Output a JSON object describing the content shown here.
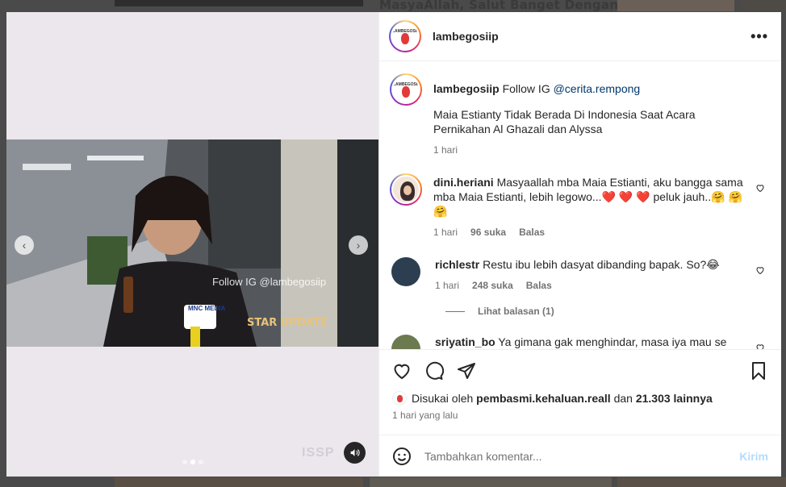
{
  "background": {
    "headline": "MasyaAllah, Salut Banget Dengan"
  },
  "post": {
    "username": "lambegosiip",
    "logo_text": "LAMBEGOSIIP",
    "video": {
      "overlay_text": "Follow IG @lambegosiip",
      "brand_text": "STAR UPDATE",
      "mic_label": "MNC MEDIA",
      "corner_watermark": "ISSP",
      "slide_count": 3,
      "active_slide": 2
    },
    "caption": {
      "username": "lambegosiip",
      "prefix": "Follow IG",
      "mention": "@cerita.rempong",
      "text": "Maia Estianty Tidak Berada Di Indonesia Saat Acara Pernikahan Al Ghazali dan Alyssa",
      "time": "1 hari"
    },
    "comments": [
      {
        "username": "dini.heriani",
        "text": "Masyaallah mba Maia Estianti, aku bangga sama mba Maia Estianti, lebih legowo...❤️ ❤️ ❤️ peluk jauh..🤗 🤗 🤗",
        "time": "1 hari",
        "likes": "96 suka",
        "reply": "Balas",
        "avatar_color": "#f3e5d8"
      },
      {
        "username": "richlestr",
        "text": "Restu ibu lebih dasyat dibanding bapak. So?😂",
        "time": "1 hari",
        "likes": "248 suka",
        "reply": "Balas",
        "view_replies": "Lihat balasan (1)",
        "avatar_color": "#2c3e50"
      },
      {
        "username": "sriyatin_bo",
        "text": "Ya gimana gak menghindar, masa iya mau se jajar",
        "avatar_color": "#6b7a4f"
      }
    ],
    "likes": {
      "prefix": "Disukai oleh",
      "user": "pembasmi.kehaluan.reall",
      "connector": "dan",
      "others": "21.303 lainnya"
    },
    "time_ago": "1 hari yang lalu",
    "comment_input": {
      "placeholder": "Tambahkan komentar...",
      "post_label": "Kirim"
    }
  }
}
